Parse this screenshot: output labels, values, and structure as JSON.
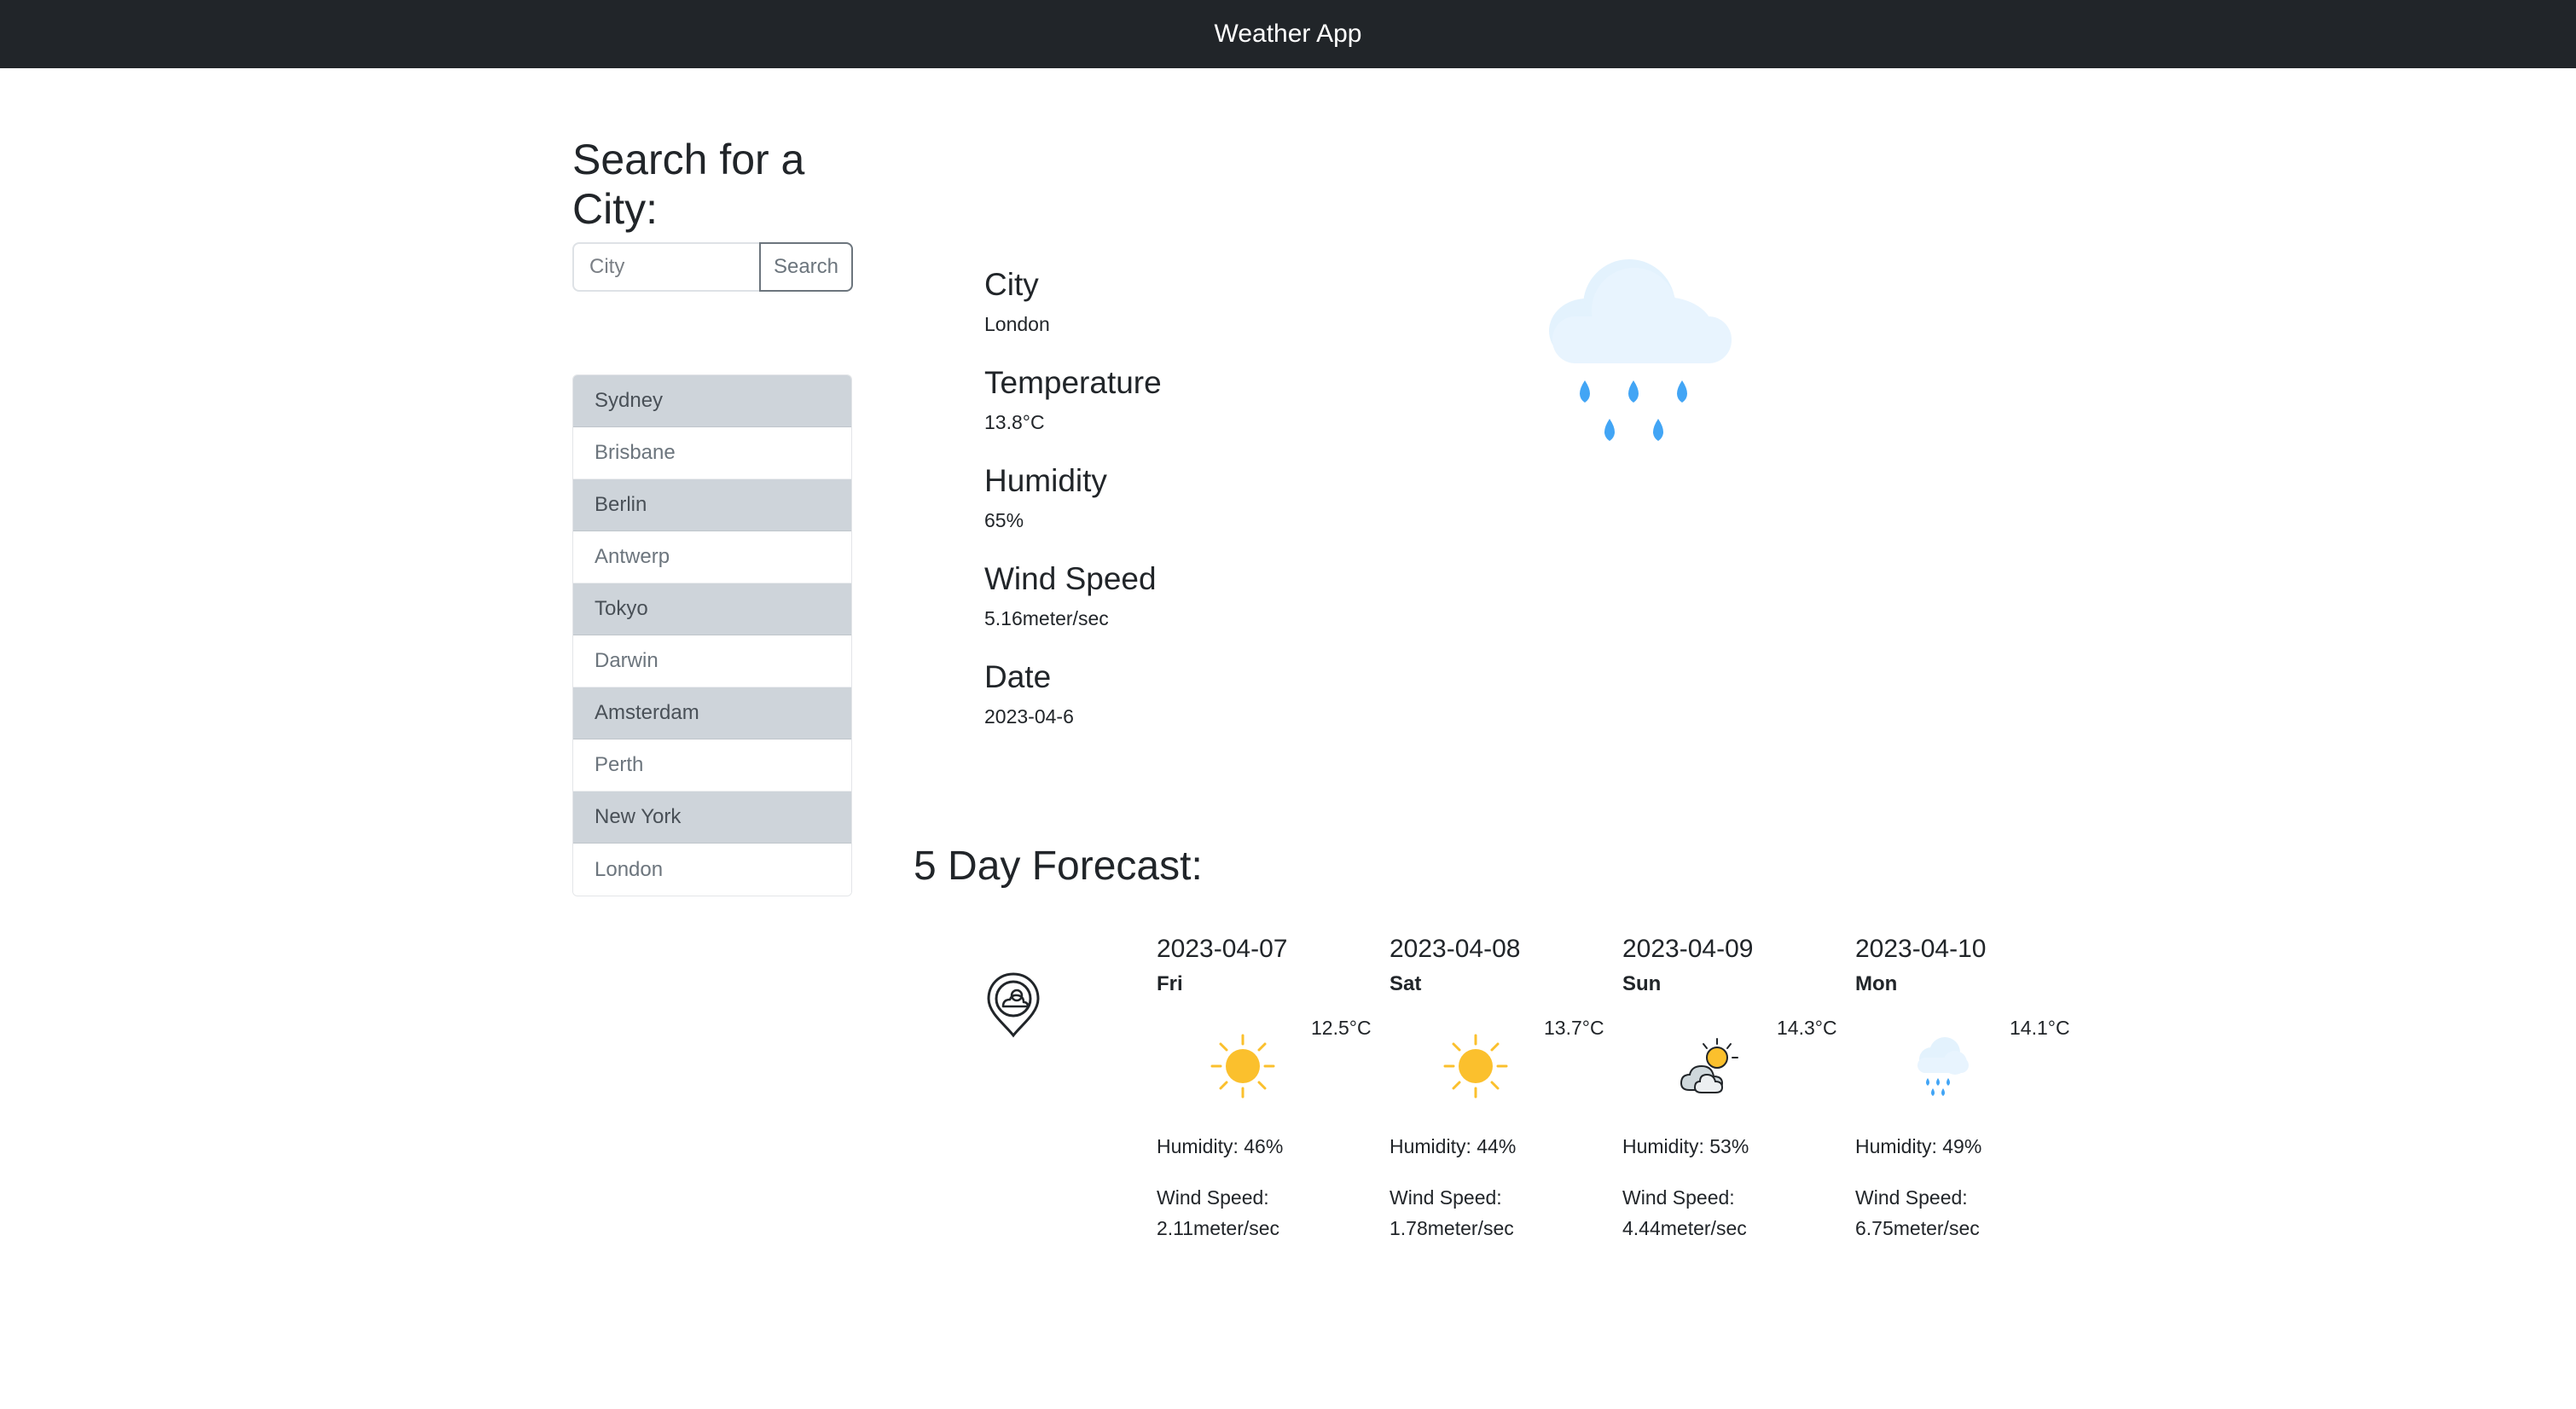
{
  "header": {
    "title": "Weather App"
  },
  "search": {
    "title": "Search for a City:",
    "placeholder": "City",
    "value": "",
    "button_label": "Search"
  },
  "history": {
    "cities": [
      "Sydney",
      "Brisbane",
      "Berlin",
      "Antwerp",
      "Tokyo",
      "Darwin",
      "Amsterdam",
      "Perth",
      "New York",
      "London"
    ]
  },
  "current": {
    "city_label": "City",
    "city": "London",
    "temperature_label": "Temperature",
    "temperature": "13.8°C",
    "humidity_label": "Humidity",
    "humidity": "65%",
    "wind_label": "Wind Speed",
    "wind": "5.16meter/sec",
    "date_label": "Date",
    "date": "2023-04-6",
    "icon": "rain-cloud-icon"
  },
  "forecast": {
    "title": "5 Day Forecast:",
    "location_icon": "weather-pin-icon",
    "days": [
      {
        "date": "2023-04-07",
        "day": "Fri",
        "temp": "12.5°C",
        "icon": "sun-icon",
        "humidity": "Humidity: 46%",
        "wind_label": "Wind Speed:",
        "wind": "2.11meter/sec"
      },
      {
        "date": "2023-04-08",
        "day": "Sat",
        "temp": "13.7°C",
        "icon": "sun-icon",
        "humidity": "Humidity: 44%",
        "wind_label": "Wind Speed:",
        "wind": "1.78meter/sec"
      },
      {
        "date": "2023-04-09",
        "day": "Sun",
        "temp": "14.3°C",
        "icon": "partly-cloudy-icon",
        "humidity": "Humidity: 53%",
        "wind_label": "Wind Speed:",
        "wind": "4.44meter/sec"
      },
      {
        "date": "2023-04-10",
        "day": "Mon",
        "temp": "14.1°C",
        "icon": "light-rain-icon",
        "humidity": "Humidity: 49%",
        "wind_label": "Wind Speed:",
        "wind": "6.75meter/sec"
      }
    ]
  },
  "colors": {
    "navbar": "#212529",
    "list_active": "#ced4da",
    "sun": "#fbc02d",
    "rain": "#42a5f5",
    "cloud": "#e3f2fd"
  }
}
